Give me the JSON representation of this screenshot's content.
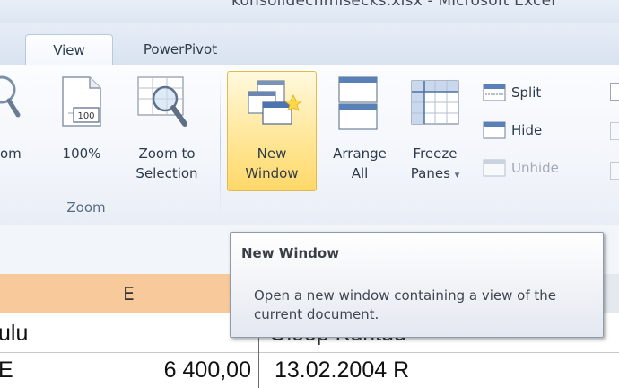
{
  "window": {
    "title": "konsolidechmisecks.xlsx  -  Microsoft Excel"
  },
  "tabs": [
    {
      "label": "View",
      "active": true
    },
    {
      "label": "PowerPivot",
      "active": false
    }
  ],
  "ribbon": {
    "zoom_group": {
      "zoom_partial_label": "om",
      "hundred_label": "100%",
      "hundred_icon_text": "100",
      "zoom_selection_line1": "Zoom to",
      "zoom_selection_line2": "Selection",
      "group_label": "Zoom"
    },
    "window_group": {
      "new_window_line1": "New",
      "new_window_line2": "Window",
      "arrange_line1": "Arrange",
      "arrange_line2": "All",
      "freeze_line1": "Freeze",
      "freeze_line2": "Panes",
      "freeze_dropdown": "▾",
      "split": "Split",
      "hide": "Hide",
      "unhide": "Unhide"
    }
  },
  "tooltip": {
    "title": "New Window",
    "body": "Open a new window containing a view of the current document."
  },
  "sheet": {
    "column_e": "E",
    "row_header_partial": "ulu",
    "row_header_partial_f": "Oloop Kuritud",
    "row1_e_prefix": "E",
    "row1_e_value": "6 400,00",
    "row1_f_value": "13.02.2004 R"
  },
  "colors": {
    "ribbon_bg": "#f3f6fb",
    "highlight": "#ffe79a",
    "column_header_selected": "#f8c99b"
  }
}
